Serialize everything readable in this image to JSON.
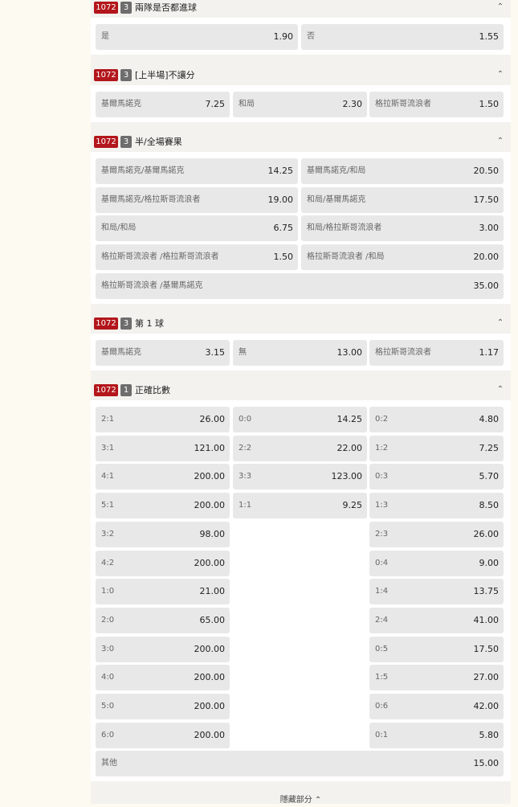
{
  "markets": [
    {
      "code": "1072",
      "count": "3",
      "title": "兩隊是否都進球",
      "rows": [
        [
          {
            "name": "是",
            "odds": "1.90"
          },
          {
            "name": "否",
            "odds": "1.55"
          }
        ]
      ]
    },
    {
      "code": "1072",
      "count": "3",
      "title": "[上半場]不讓分",
      "rows": [
        [
          {
            "name": "基爾馬諾克",
            "odds": "7.25"
          },
          {
            "name": "和局",
            "odds": "2.30"
          },
          {
            "name": "格拉斯哥流浪者",
            "odds": "1.50"
          }
        ]
      ]
    },
    {
      "code": "1072",
      "count": "3",
      "title": "半/全場賽果",
      "rows": [
        [
          {
            "name": "基爾馬諾克/基爾馬諾克",
            "odds": "14.25"
          },
          {
            "name": "基爾馬諾克/和局",
            "odds": "20.50"
          }
        ],
        [
          {
            "name": "基爾馬諾克/格拉斯哥流浪者",
            "odds": "19.00"
          },
          {
            "name": "和局/基爾馬諾克",
            "odds": "17.50"
          }
        ],
        [
          {
            "name": "和局/和局",
            "odds": "6.75"
          },
          {
            "name": "和局/格拉斯哥流浪者",
            "odds": "3.00"
          }
        ],
        [
          {
            "name": "格拉斯哥流浪者 /格拉斯哥流浪者",
            "odds": "1.50"
          },
          {
            "name": "格拉斯哥流浪者 /和局",
            "odds": "20.00"
          }
        ],
        [
          {
            "name": "格拉斯哥流浪者 /基爾馬諾克",
            "odds": "35.00"
          }
        ]
      ]
    },
    {
      "code": "1072",
      "count": "3",
      "title": "第 1 球",
      "rows": [
        [
          {
            "name": "基爾馬諾克",
            "odds": "3.15"
          },
          {
            "name": "無",
            "odds": "13.00"
          },
          {
            "name": "格拉斯哥流浪者",
            "odds": "1.17"
          }
        ]
      ]
    },
    {
      "code": "1072",
      "count": "1",
      "title": "正確比數",
      "rows": [
        [
          {
            "name": "2:1",
            "odds": "26.00"
          },
          {
            "name": "0:0",
            "odds": "14.25"
          },
          {
            "name": "0:2",
            "odds": "4.80"
          }
        ],
        [
          {
            "name": "3:1",
            "odds": "121.00"
          },
          {
            "name": "2:2",
            "odds": "22.00"
          },
          {
            "name": "1:2",
            "odds": "7.25"
          }
        ],
        [
          {
            "name": "4:1",
            "odds": "200.00"
          },
          {
            "name": "3:3",
            "odds": "123.00"
          },
          {
            "name": "0:3",
            "odds": "5.70"
          }
        ],
        [
          {
            "name": "5:1",
            "odds": "200.00"
          },
          {
            "name": "1:1",
            "odds": "9.25"
          },
          {
            "name": "1:3",
            "odds": "8.50"
          }
        ],
        [
          {
            "name": "3:2",
            "odds": "98.00"
          },
          null,
          {
            "name": "2:3",
            "odds": "26.00"
          }
        ],
        [
          {
            "name": "4:2",
            "odds": "200.00"
          },
          null,
          {
            "name": "0:4",
            "odds": "9.00"
          }
        ],
        [
          {
            "name": "1:0",
            "odds": "21.00"
          },
          null,
          {
            "name": "1:4",
            "odds": "13.75"
          }
        ],
        [
          {
            "name": "2:0",
            "odds": "65.00"
          },
          null,
          {
            "name": "2:4",
            "odds": "41.00"
          }
        ],
        [
          {
            "name": "3:0",
            "odds": "200.00"
          },
          null,
          {
            "name": "0:5",
            "odds": "17.50"
          }
        ],
        [
          {
            "name": "4:0",
            "odds": "200.00"
          },
          null,
          {
            "name": "1:5",
            "odds": "27.00"
          }
        ],
        [
          {
            "name": "5:0",
            "odds": "200.00"
          },
          null,
          {
            "name": "0:6",
            "odds": "42.00"
          }
        ],
        [
          {
            "name": "6:0",
            "odds": "200.00"
          },
          null,
          {
            "name": "0:1",
            "odds": "5.80"
          }
        ],
        [
          {
            "name": "其他",
            "odds": "15.00"
          }
        ]
      ]
    }
  ],
  "footer": {
    "label": "隱藏部分"
  },
  "icons": {
    "collapse": "chevron-up-icon"
  },
  "colors": {
    "code_badge": "#b3161b",
    "count_badge": "#6d6d6d",
    "cell_bg": "#e8e8e8"
  }
}
